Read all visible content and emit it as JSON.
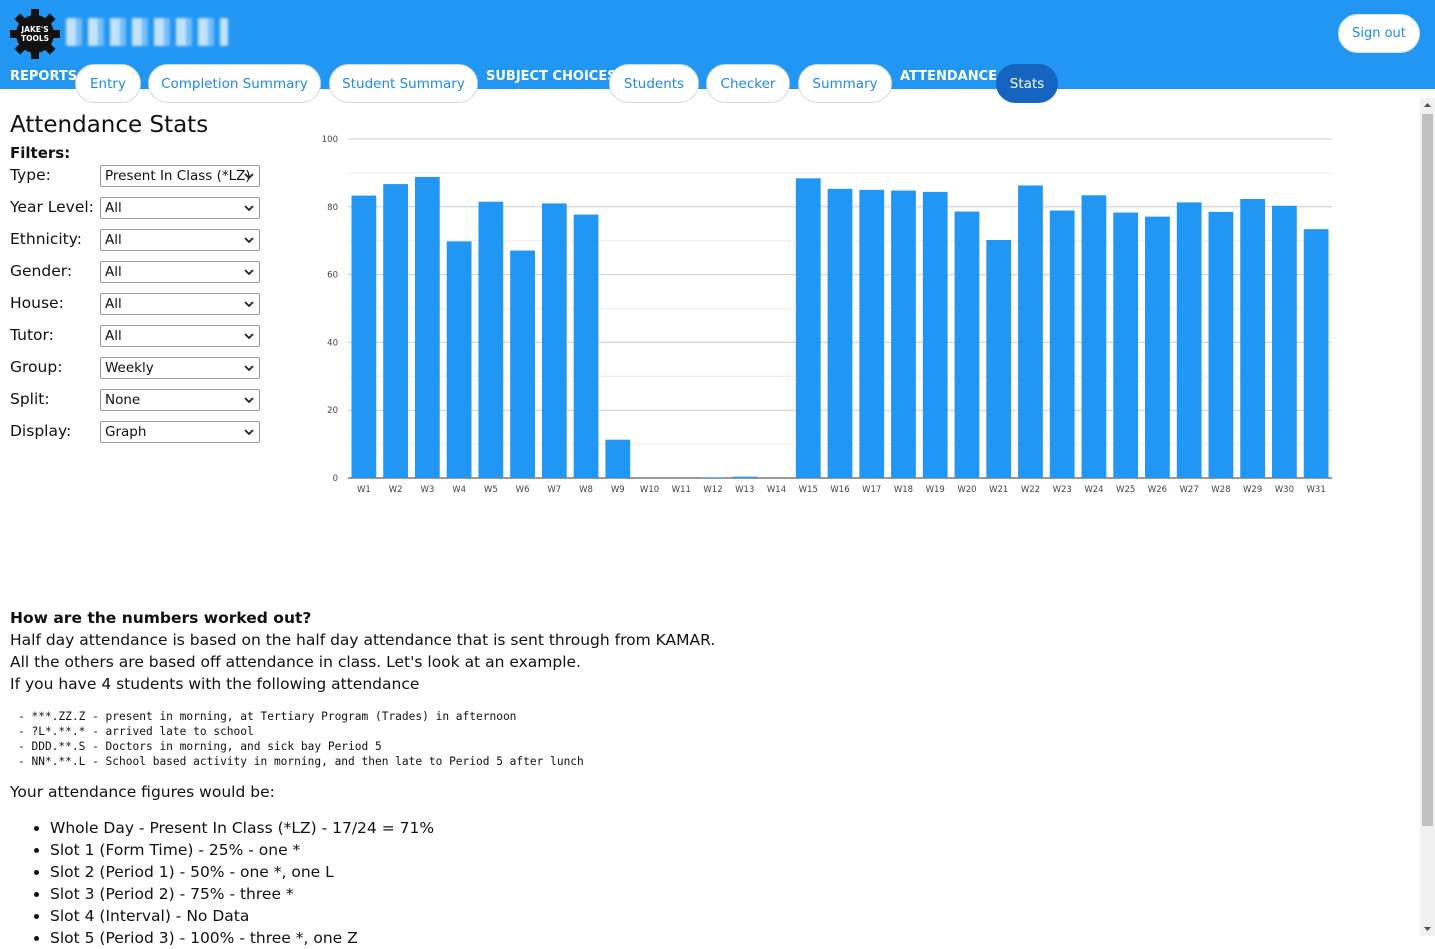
{
  "header": {
    "logo_text_line1": "JAKE'S",
    "logo_text_line2": "TOOLS",
    "sign_out_label": "Sign out"
  },
  "nav": {
    "reports_section": "REPORTS",
    "subject_choices_section": "SUBJECT CHOICES",
    "attendance_section": "ATTENDANCE",
    "tabs": [
      {
        "label": "Entry"
      },
      {
        "label": "Completion Summary"
      },
      {
        "label": "Student Summary"
      },
      {
        "label": "Students"
      },
      {
        "label": "Checker"
      },
      {
        "label": "Summary"
      },
      {
        "label": "Stats",
        "active": true
      }
    ]
  },
  "page": {
    "title": "Attendance Stats",
    "filters_heading": "Filters:"
  },
  "filters": [
    {
      "label": "Type:",
      "value": "Present In Class (*LZ)"
    },
    {
      "label": "Year Level:",
      "value": "All"
    },
    {
      "label": "Ethnicity:",
      "value": "All"
    },
    {
      "label": "Gender:",
      "value": "All"
    },
    {
      "label": "House:",
      "value": "All"
    },
    {
      "label": "Tutor:",
      "value": "All"
    },
    {
      "label": "Group:",
      "value": "Weekly"
    },
    {
      "label": "Split:",
      "value": "None"
    },
    {
      "label": "Display:",
      "value": "Graph"
    }
  ],
  "chart_data": {
    "type": "bar",
    "categories": [
      "W1",
      "W2",
      "W3",
      "W4",
      "W5",
      "W6",
      "W7",
      "W8",
      "W9",
      "W10",
      "W11",
      "W12",
      "W13",
      "W14",
      "W15",
      "W16",
      "W17",
      "W18",
      "W19",
      "W20",
      "W21",
      "W22",
      "W23",
      "W24",
      "W25",
      "W26",
      "W27",
      "W28",
      "W29",
      "W30",
      "W31"
    ],
    "values": [
      83.3,
      86.7,
      88.8,
      69.8,
      81.5,
      67.1,
      81.0,
      77.7,
      11.3,
      0,
      0,
      0.2,
      0.4,
      0,
      88.4,
      85.3,
      85.0,
      84.8,
      84.4,
      78.6,
      70.2,
      86.3,
      78.9,
      83.4,
      78.3,
      77.1,
      81.3,
      78.5,
      82.3,
      80.3,
      73.4
    ],
    "yticks": [
      "0",
      "20",
      "40",
      "60",
      "80",
      "100"
    ],
    "ylim": [
      0,
      100
    ],
    "grid": true,
    "bar_color": "#2196f3"
  },
  "explanation": {
    "heading": "How are the numbers worked out?",
    "lines": [
      "Half day attendance is based on the half day attendance that is sent through from KAMAR.",
      "All the others are based off attendance in class. Let's look at an example.",
      "If you have 4 students with the following attendance"
    ],
    "code_lines": [
      "- ***.ZZ.Z - present in morning, at Tertiary Program (Trades) in afternoon",
      "- ?L*.**.* - arrived late to school",
      "- DDD.**.S - Doctors in morning, and sick bay Period 5",
      "- NN*.**.L - School based activity in morning, and then late to Period 5 after lunch"
    ],
    "figures_intro": "Your attendance figures would be:",
    "figures": [
      "Whole Day - Present In Class (*LZ) - 17/24 = 71%",
      "Slot 1 (Form Time) - 25% - one *",
      "Slot 2 (Period 1) - 50% - one *, one L",
      "Slot 3 (Period 2) - 75% - three *",
      "Slot 4 (Interval) - No Data",
      "Slot 5 (Period 3) - 100% - three *, one Z"
    ]
  }
}
